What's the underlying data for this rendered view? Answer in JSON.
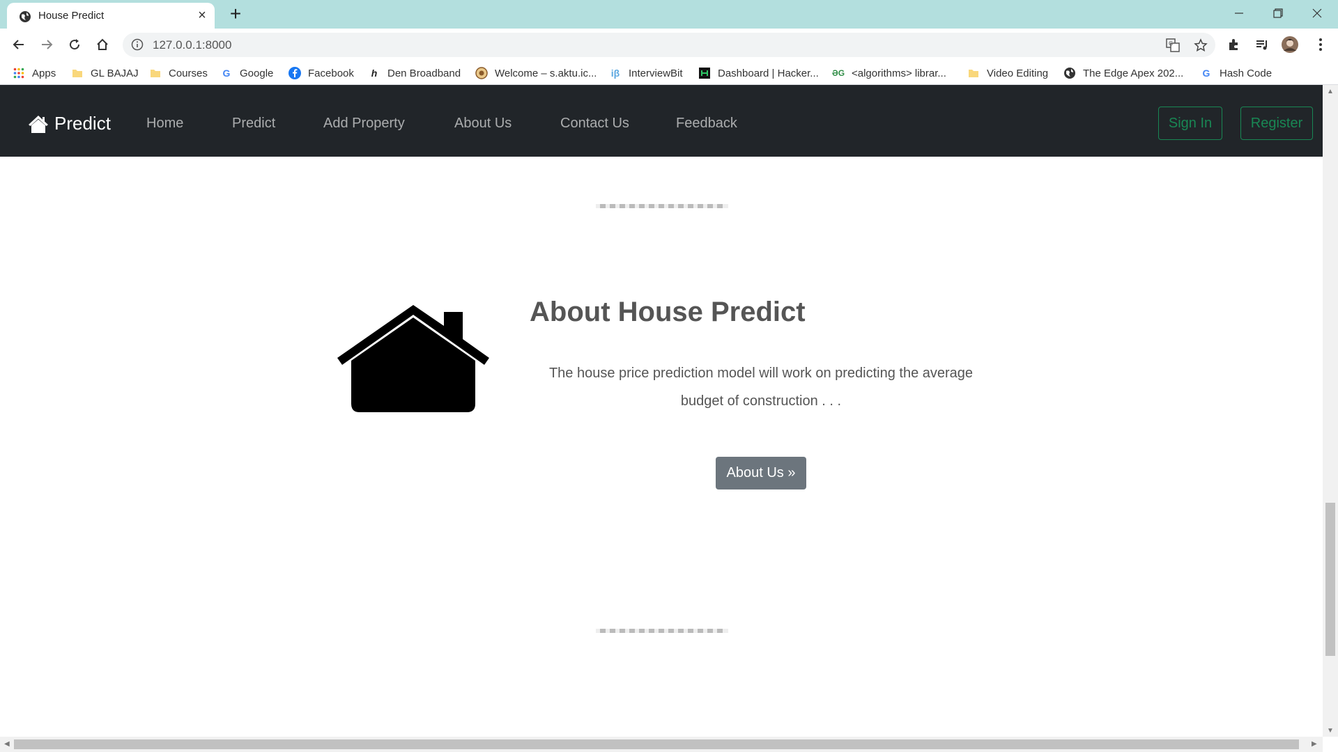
{
  "browser": {
    "tab_title": "House Predict",
    "url": "127.0.0.1:8000",
    "bookmarks": [
      {
        "label": "Apps",
        "icon": "apps-grid-icon"
      },
      {
        "label": "GL BAJAJ",
        "icon": "folder-icon"
      },
      {
        "label": "Courses",
        "icon": "folder-icon"
      },
      {
        "label": "Google",
        "icon": "google-icon"
      },
      {
        "label": "Facebook",
        "icon": "facebook-icon"
      },
      {
        "label": "Den Broadband",
        "icon": "den-icon"
      },
      {
        "label": "Welcome – s.aktu.ic...",
        "icon": "aktu-icon"
      },
      {
        "label": "InterviewBit",
        "icon": "interviewbit-icon"
      },
      {
        "label": "Dashboard | Hacker...",
        "icon": "hackerrank-icon"
      },
      {
        "label": "<algorithms> librar...",
        "icon": "gfg-icon"
      },
      {
        "label": "Video Editing",
        "icon": "folder-icon"
      },
      {
        "label": "The Edge Apex 202...",
        "icon": "globe-icon"
      },
      {
        "label": "Hash Code",
        "icon": "google-icon"
      }
    ]
  },
  "navbar": {
    "brand": "Predict",
    "links": [
      "Home",
      "Predict",
      "Add Property",
      "About Us",
      "Contact Us",
      "Feedback"
    ],
    "sign_in": "Sign In",
    "register": "Register"
  },
  "about": {
    "title": "About House Predict",
    "text": "The house price prediction model will work on predicting the average budget of construction . . .",
    "button": "About Us »"
  },
  "colors": {
    "tabstrip": "#b3dfde",
    "navbar": "#212529",
    "outline_success": "#198754",
    "secondary_button": "#6c757d"
  }
}
